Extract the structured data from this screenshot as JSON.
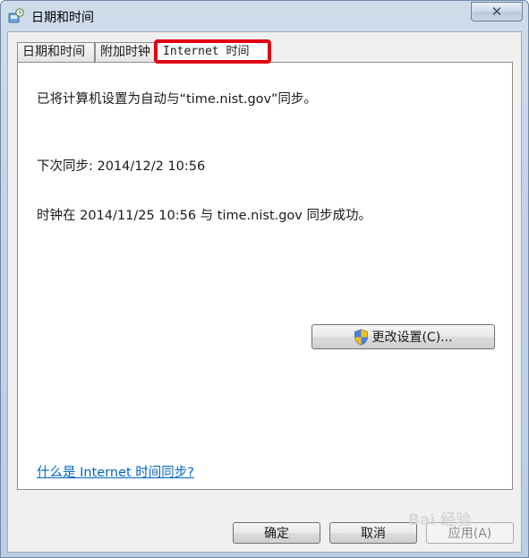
{
  "window": {
    "title": "日期和时间",
    "close_label": "✕"
  },
  "tabs": [
    {
      "label": "日期和时间",
      "active": false
    },
    {
      "label": "附加时钟",
      "active": false
    },
    {
      "label": "Internet 时间",
      "active": true
    }
  ],
  "panel": {
    "sync_status": "已将计算机设置为自动与“time.nist.gov”同步。",
    "next_sync": "下次同步: 2014/12/2 10:56",
    "last_sync": "时钟在 2014/11/25 10:56 与 time.nist.gov 同步成功。",
    "change_settings_label": "更改设置(C)...",
    "help_link": "什么是 Internet 时间同步?"
  },
  "footer": {
    "ok_label": "确定",
    "cancel_label": "取消",
    "apply_label": "应用(A)"
  },
  "watermark": "Bai 经验",
  "colors": {
    "active_tab_highlight": "#e00010",
    "link": "#0066cc"
  },
  "icons": {
    "title": "clock-globe-icon",
    "change_settings": "uac-shield-icon"
  }
}
